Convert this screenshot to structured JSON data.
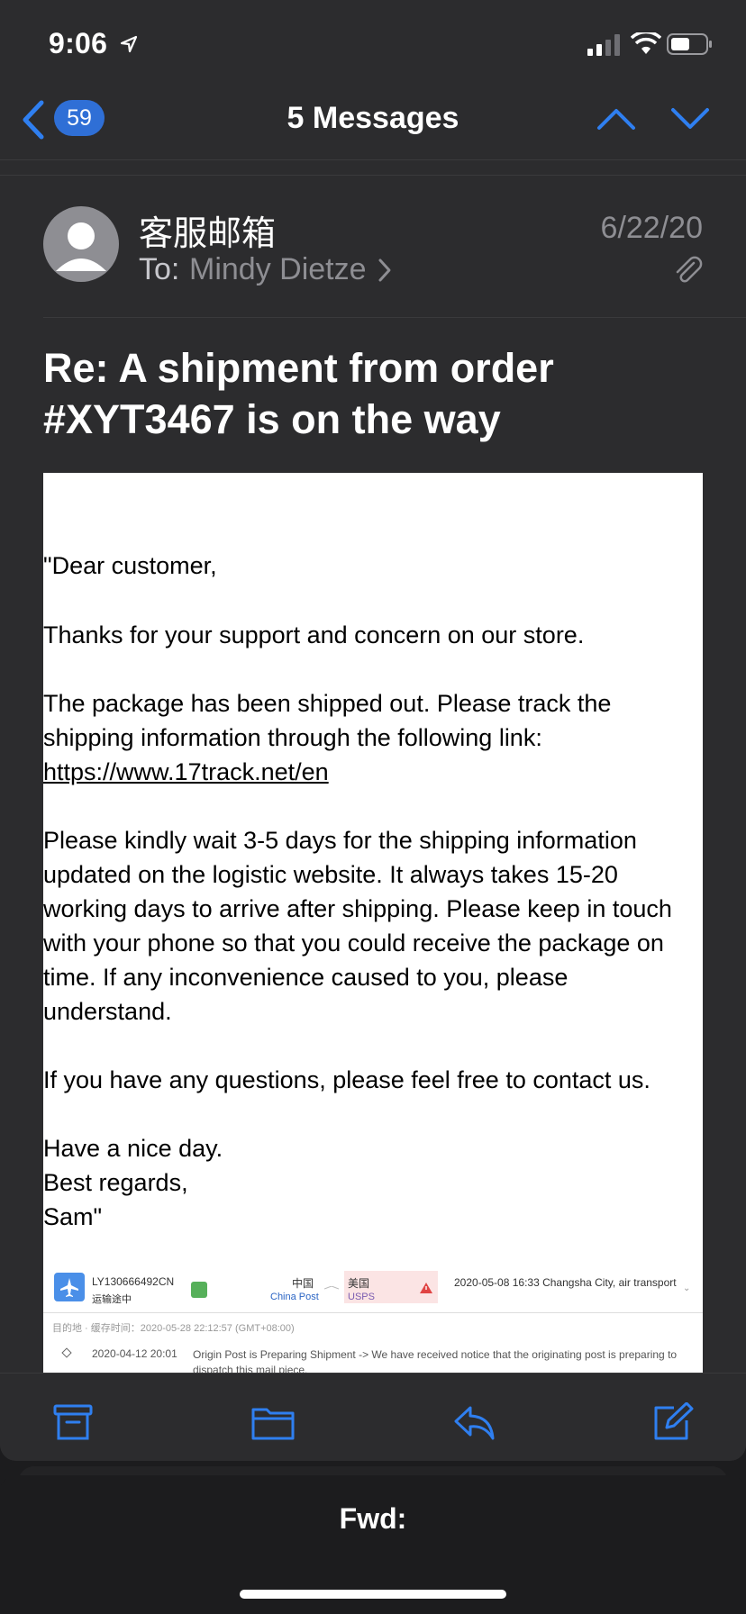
{
  "status_bar": {
    "time": "9:06"
  },
  "nav": {
    "back_count": "59",
    "title": "5 Messages"
  },
  "header": {
    "sender": "客服邮箱",
    "to_label": "To:",
    "recipient": "Mindy Dietze",
    "date": "6/22/20"
  },
  "subject": "Re:  A shipment from order #XYT3467 is on the way",
  "body": {
    "greeting": " \"Dear customer,",
    "p1": "Thanks for your support and concern on our store.",
    "p2": "The package has been shipped out. Please track the shipping information through the following link:",
    "link": "https://www.17track.net/en",
    "p3": "Please kindly wait 3-5 days for the shipping information updated on the logistic website. It always takes 15-20 working days to arrive after shipping. Please keep in touch with your phone so that you could receive the package on time. If any inconvenience caused to you, please understand.",
    "p4": "If you have any questions, please feel free to contact us.",
    "closing1": "Have a nice day.",
    "closing2": "Best regards,",
    "closing3": "Sam\""
  },
  "tracking": {
    "number": "LY130666492CN",
    "status": "运输途中",
    "origin_country": "中国",
    "origin_carrier": "China Post",
    "dest_country": "美国",
    "dest_carrier": "USPS",
    "latest": "2020-05-08 16:33  Changsha City, air transport",
    "dest_line": "目的地 · 缓存时间：2020-05-28 22:12:57 (GMT+08:00)",
    "event_time": "2020-04-12 20:01",
    "event_text": "Origin Post is Preparing Shipment -> We have received notice that the originating post is preparing to dispatch this mail piece."
  },
  "toolbar": {
    "icons": [
      "archive-icon",
      "folder-icon",
      "reply-icon",
      "compose-icon"
    ]
  },
  "draft": {
    "title": "Fwd:"
  },
  "colors": {
    "accent": "#2f6fd6",
    "background": "#2c2c2e"
  }
}
